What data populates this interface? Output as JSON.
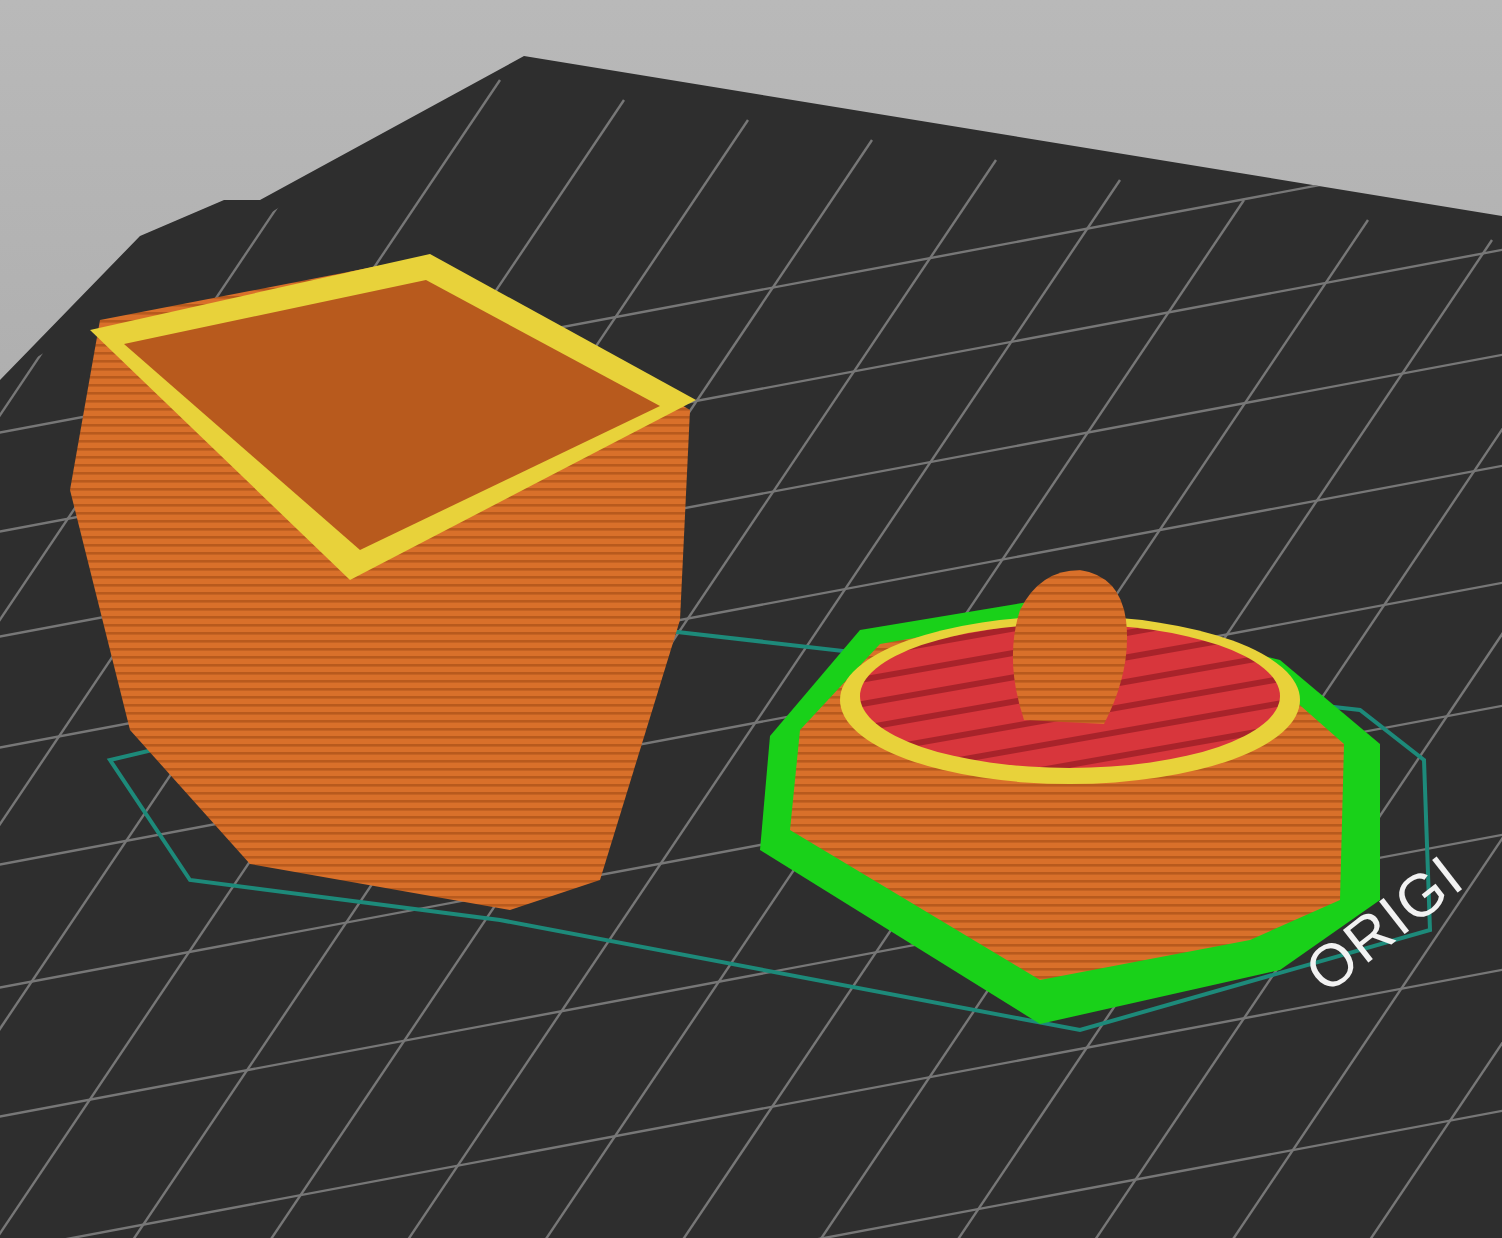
{
  "viewport": {
    "bed_label": "ORIGI"
  }
}
